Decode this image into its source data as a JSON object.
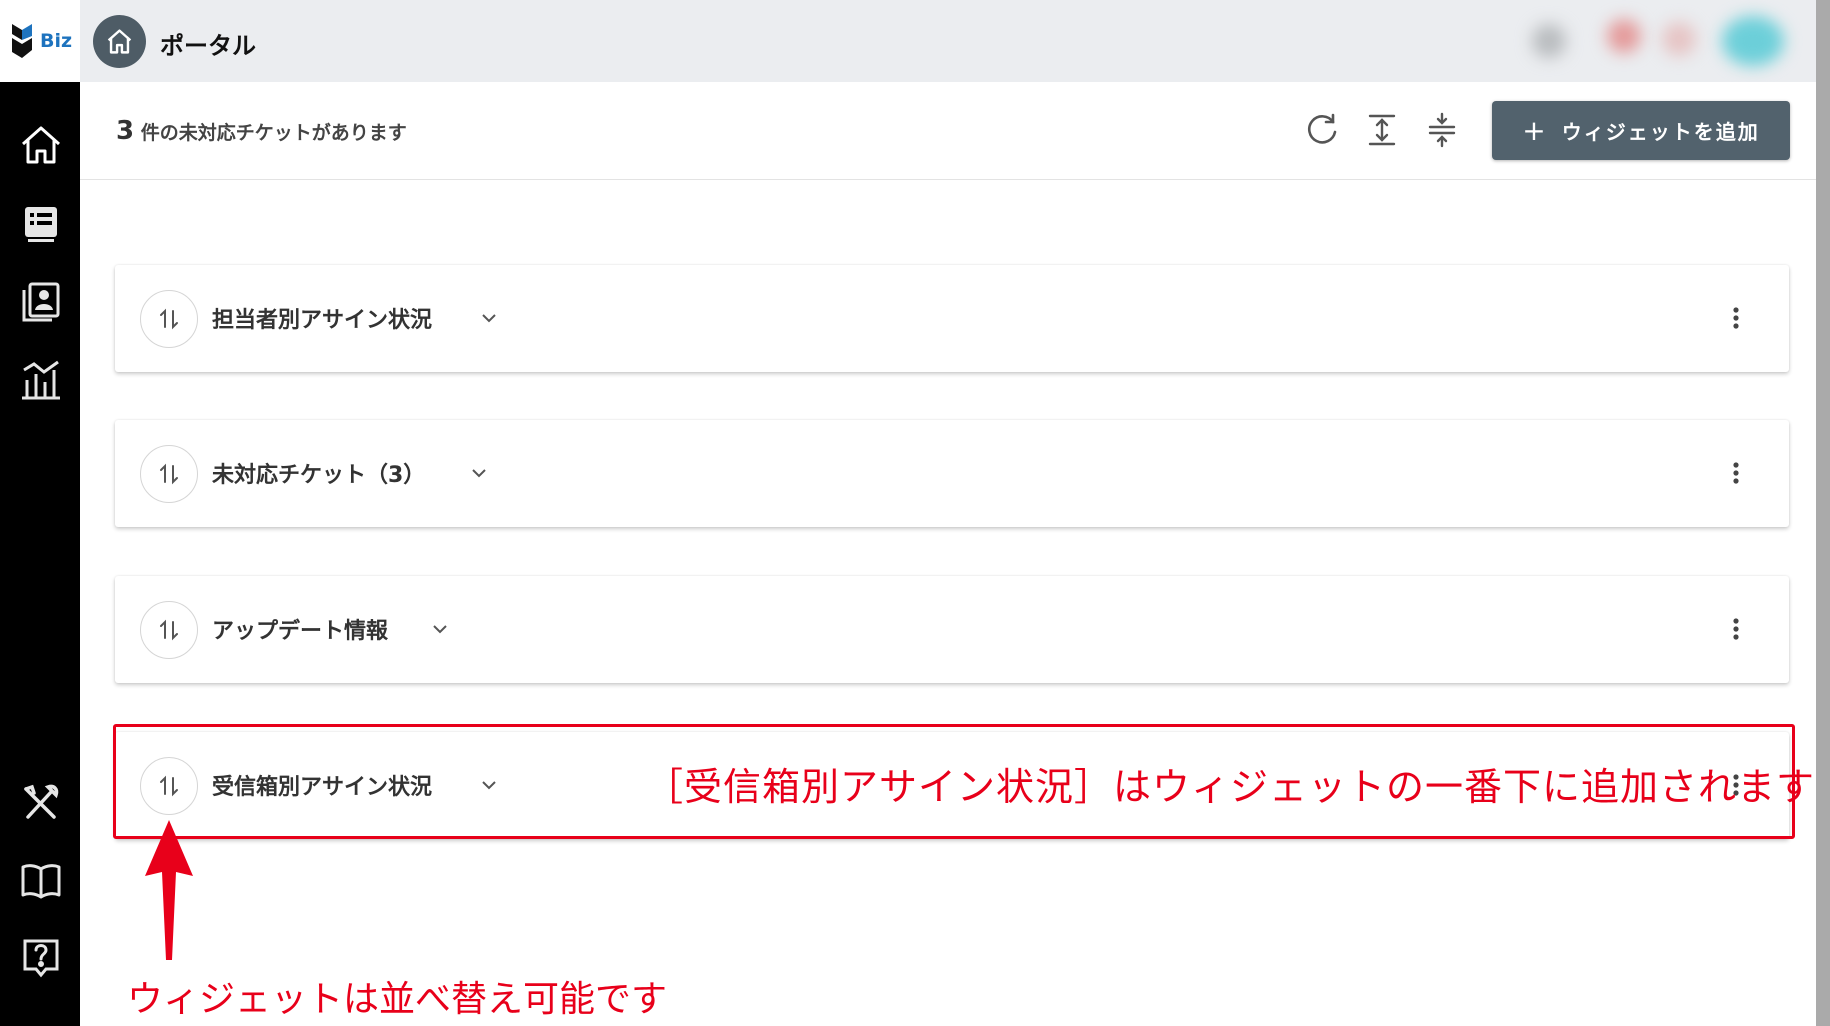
{
  "app": {
    "brand": "Biz",
    "page_title": "ポータル"
  },
  "toolbar": {
    "unhandled_count": "3",
    "unhandled_suffix": "件の未対応チケットがあります",
    "add_widget_label": "ウィジェットを追加",
    "icons": [
      "refresh-icon",
      "expand-all-icon",
      "collapse-all-icon"
    ]
  },
  "sidebar": {
    "icons": [
      "home-icon",
      "ticket-list-icon",
      "contacts-icon",
      "reports-icon",
      "tools-icon",
      "manual-icon",
      "help-icon"
    ]
  },
  "widgets": [
    {
      "title": "担当者別アサイン状況"
    },
    {
      "title": "未対応チケット（3）"
    },
    {
      "title": "アップデート情報"
    },
    {
      "title": "受信箱別アサイン状況"
    }
  ],
  "annotations": {
    "added_note": "［受信箱別アサイン状況］はウィジェットの一番下に追加されます",
    "sort_note": "ウィジェットは並べ替え可能です"
  },
  "colors": {
    "sidebar_bg": "#000000",
    "button_bg": "#52626d",
    "annotation": "#e8001a",
    "brand": "#1e73be"
  }
}
